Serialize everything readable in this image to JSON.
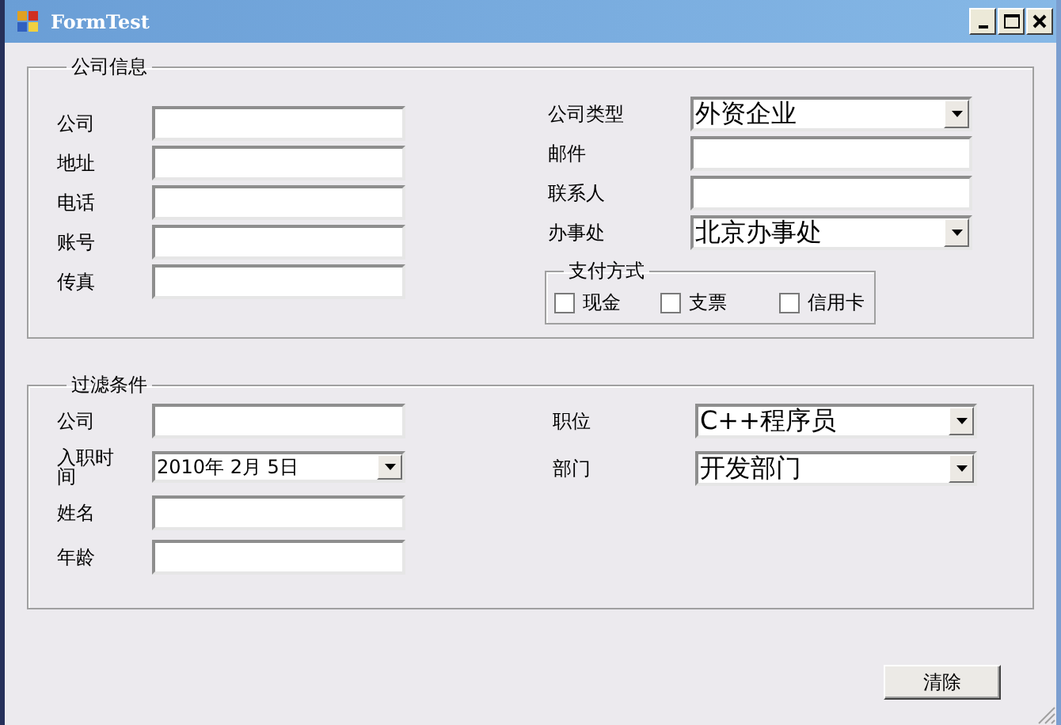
{
  "window": {
    "title": "FormTest"
  },
  "company_info": {
    "title": "公司信息",
    "left_fields": [
      {
        "label": "公司",
        "kind": "text"
      },
      {
        "label": "地址",
        "kind": "text"
      },
      {
        "label": "电话",
        "kind": "text"
      },
      {
        "label": "账号",
        "kind": "text"
      },
      {
        "label": "传真",
        "kind": "text"
      }
    ],
    "right_fields": [
      {
        "label": "公司类型",
        "kind": "combo",
        "value": "外资企业"
      },
      {
        "label": "邮件",
        "kind": "text"
      },
      {
        "label": "联系人",
        "kind": "text"
      },
      {
        "label": "办事处",
        "kind": "combo",
        "value": "北京办事处"
      }
    ],
    "payment": {
      "title": "支付方式",
      "options": [
        {
          "label": "现金",
          "checked": false
        },
        {
          "label": "支票",
          "checked": false
        },
        {
          "label": "信用卡",
          "checked": false
        }
      ]
    }
  },
  "filter": {
    "title": "过滤条件",
    "left_fields": [
      {
        "label": "公司",
        "kind": "text"
      },
      {
        "label": "入职时间",
        "kind": "date",
        "value": "2010年 2月 5日"
      },
      {
        "label": "姓名",
        "kind": "text"
      },
      {
        "label": "年龄",
        "kind": "text"
      }
    ],
    "right_fields": [
      {
        "label": "职位",
        "kind": "combo",
        "value": "C++程序员"
      },
      {
        "label": "部门",
        "kind": "combo",
        "value": "开发部门"
      }
    ]
  },
  "buttons": [
    {
      "label": "清除"
    }
  ]
}
